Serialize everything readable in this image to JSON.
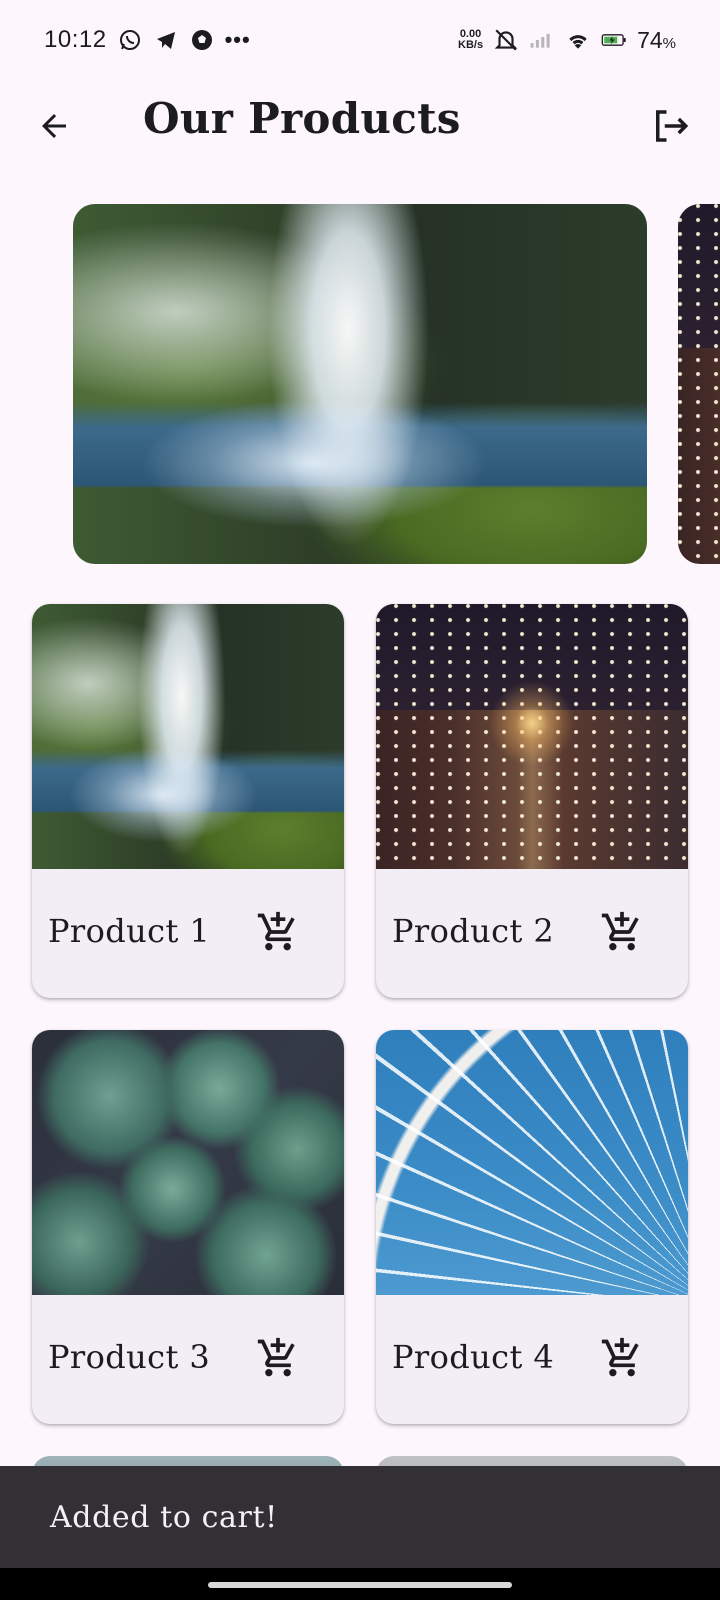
{
  "status_bar": {
    "time": "10:12",
    "more": "•••",
    "net_speed_value": "0.00",
    "net_speed_unit": "KB/s",
    "battery_percent": "74",
    "battery_unit": "%",
    "icons": [
      "whatsapp-icon",
      "telegram-icon",
      "football-icon",
      "mute-icon",
      "signal-icon",
      "wifi-icon",
      "battery-charging-icon"
    ]
  },
  "app_bar": {
    "title": "Our Products",
    "back_icon": "arrow-back-icon",
    "logout_icon": "logout-icon"
  },
  "carousel": {
    "slides": [
      "waterfall",
      "night-street"
    ]
  },
  "products": [
    {
      "name": "Product 1",
      "image": "waterfall",
      "cart_icon": "add-shopping-cart-icon"
    },
    {
      "name": "Product 2",
      "image": "night-street",
      "cart_icon": "add-shopping-cart-icon"
    },
    {
      "name": "Product 3",
      "image": "succulents",
      "cart_icon": "add-shopping-cart-icon"
    },
    {
      "name": "Product 4",
      "image": "ferris-wheel",
      "cart_icon": "add-shopping-cart-icon"
    }
  ],
  "snackbar": {
    "message": "Added to cart!"
  },
  "colors": {
    "background": "#fdf7fd",
    "card": "#f3edf6",
    "snackbar": "#322f35",
    "text": "#1c1b1f"
  }
}
